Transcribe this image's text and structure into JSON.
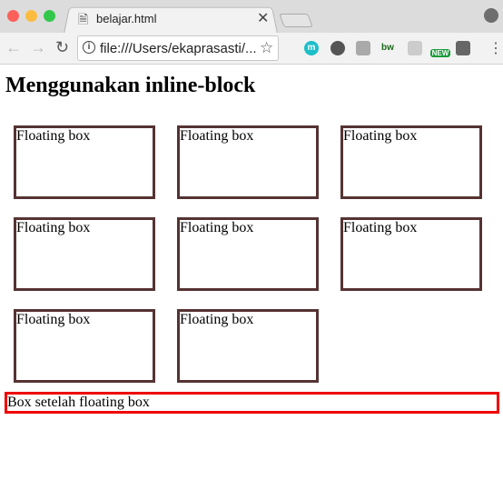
{
  "browser": {
    "tab_title": "belajar.html",
    "address": "file:///Users/ekaprasasti/...",
    "window_controls": {
      "close": "#fc605b",
      "minimize": "#fdbc40",
      "maximize": "#34c84a"
    },
    "extensions": [
      "m",
      "evernote-icon",
      "camera-icon",
      "bw",
      "pin-icon",
      "NEW",
      "bulb-icon"
    ]
  },
  "page": {
    "heading": "Menggunakan inline-block",
    "boxes": [
      "Floating box",
      "Floating box",
      "Floating box",
      "Floating box",
      "Floating box",
      "Floating box",
      "Floating box",
      "Floating box"
    ],
    "after_box": "Box setelah floating box",
    "colors": {
      "box_border": "#553333",
      "after_border": "#ee0000"
    }
  }
}
